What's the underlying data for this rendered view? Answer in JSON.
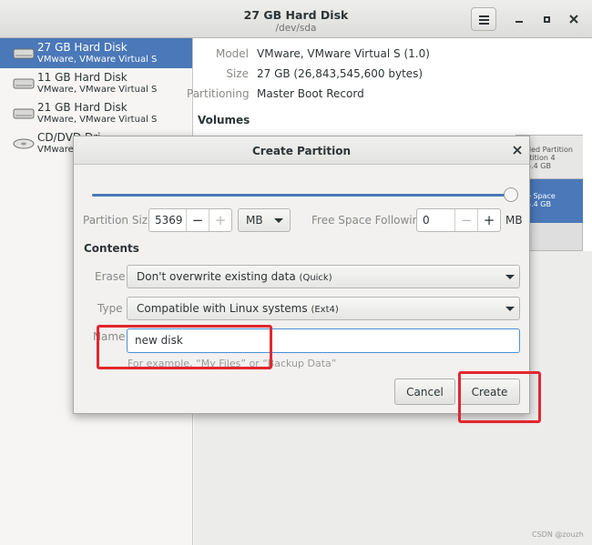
{
  "window": {
    "title": "27 GB Hard Disk",
    "subtitle": "/dev/sda"
  },
  "sidebar": {
    "items": [
      {
        "name": "27 GB Hard Disk",
        "model": "VMware, VMware Virtual S",
        "selected": true
      },
      {
        "name": "11 GB Hard Disk",
        "model": "VMware, VMware Virtual S",
        "selected": false
      },
      {
        "name": "21 GB Hard Disk",
        "model": "VMware, VMware Virtual S",
        "selected": false
      },
      {
        "name": "CD/DVD Dri",
        "model": "VMware V",
        "selected": false
      }
    ]
  },
  "details": {
    "model_label": "Model",
    "model_value": "VMware, VMware Virtual S (1.0)",
    "size_label": "Size",
    "size_value": "27 GB (26,843,545,600 bytes)",
    "partitioning_label": "Partitioning",
    "partitioning_value": "Master Boot Record",
    "volumes_heading": "Volumes",
    "volume_a": {
      "line1": "ded Partition",
      "line2": "rtition 4",
      "line3": "5.4 GB"
    },
    "volume_b": {
      "line1": "e Space",
      "line2": "5.4 GB"
    }
  },
  "dialog": {
    "title": "Create Partition",
    "partition_size_label": "Partition Size",
    "partition_size_value": "5369",
    "minus_glyph": "−",
    "plus_glyph": "+",
    "unit_value": "MB",
    "free_space_label": "Free Space Following",
    "free_space_value": "0",
    "free_space_unit": "MB",
    "contents_heading": "Contents",
    "erase_label": "Erase",
    "erase_value": "Don't overwrite existing data",
    "erase_note": "(Quick)",
    "type_label": "Type",
    "type_value": "Compatible with Linux systems",
    "type_note": "(Ext4)",
    "name_label": "Name",
    "name_value": "new disk",
    "name_hint": "For example, “My Files” or “Backup Data”",
    "cancel_label": "Cancel",
    "create_label": "Create"
  },
  "watermark": "CSDN @zouzh",
  "colors": {
    "accent": "#4a78b8",
    "annotation": "#e2262e",
    "focus": "#4a90d9"
  }
}
